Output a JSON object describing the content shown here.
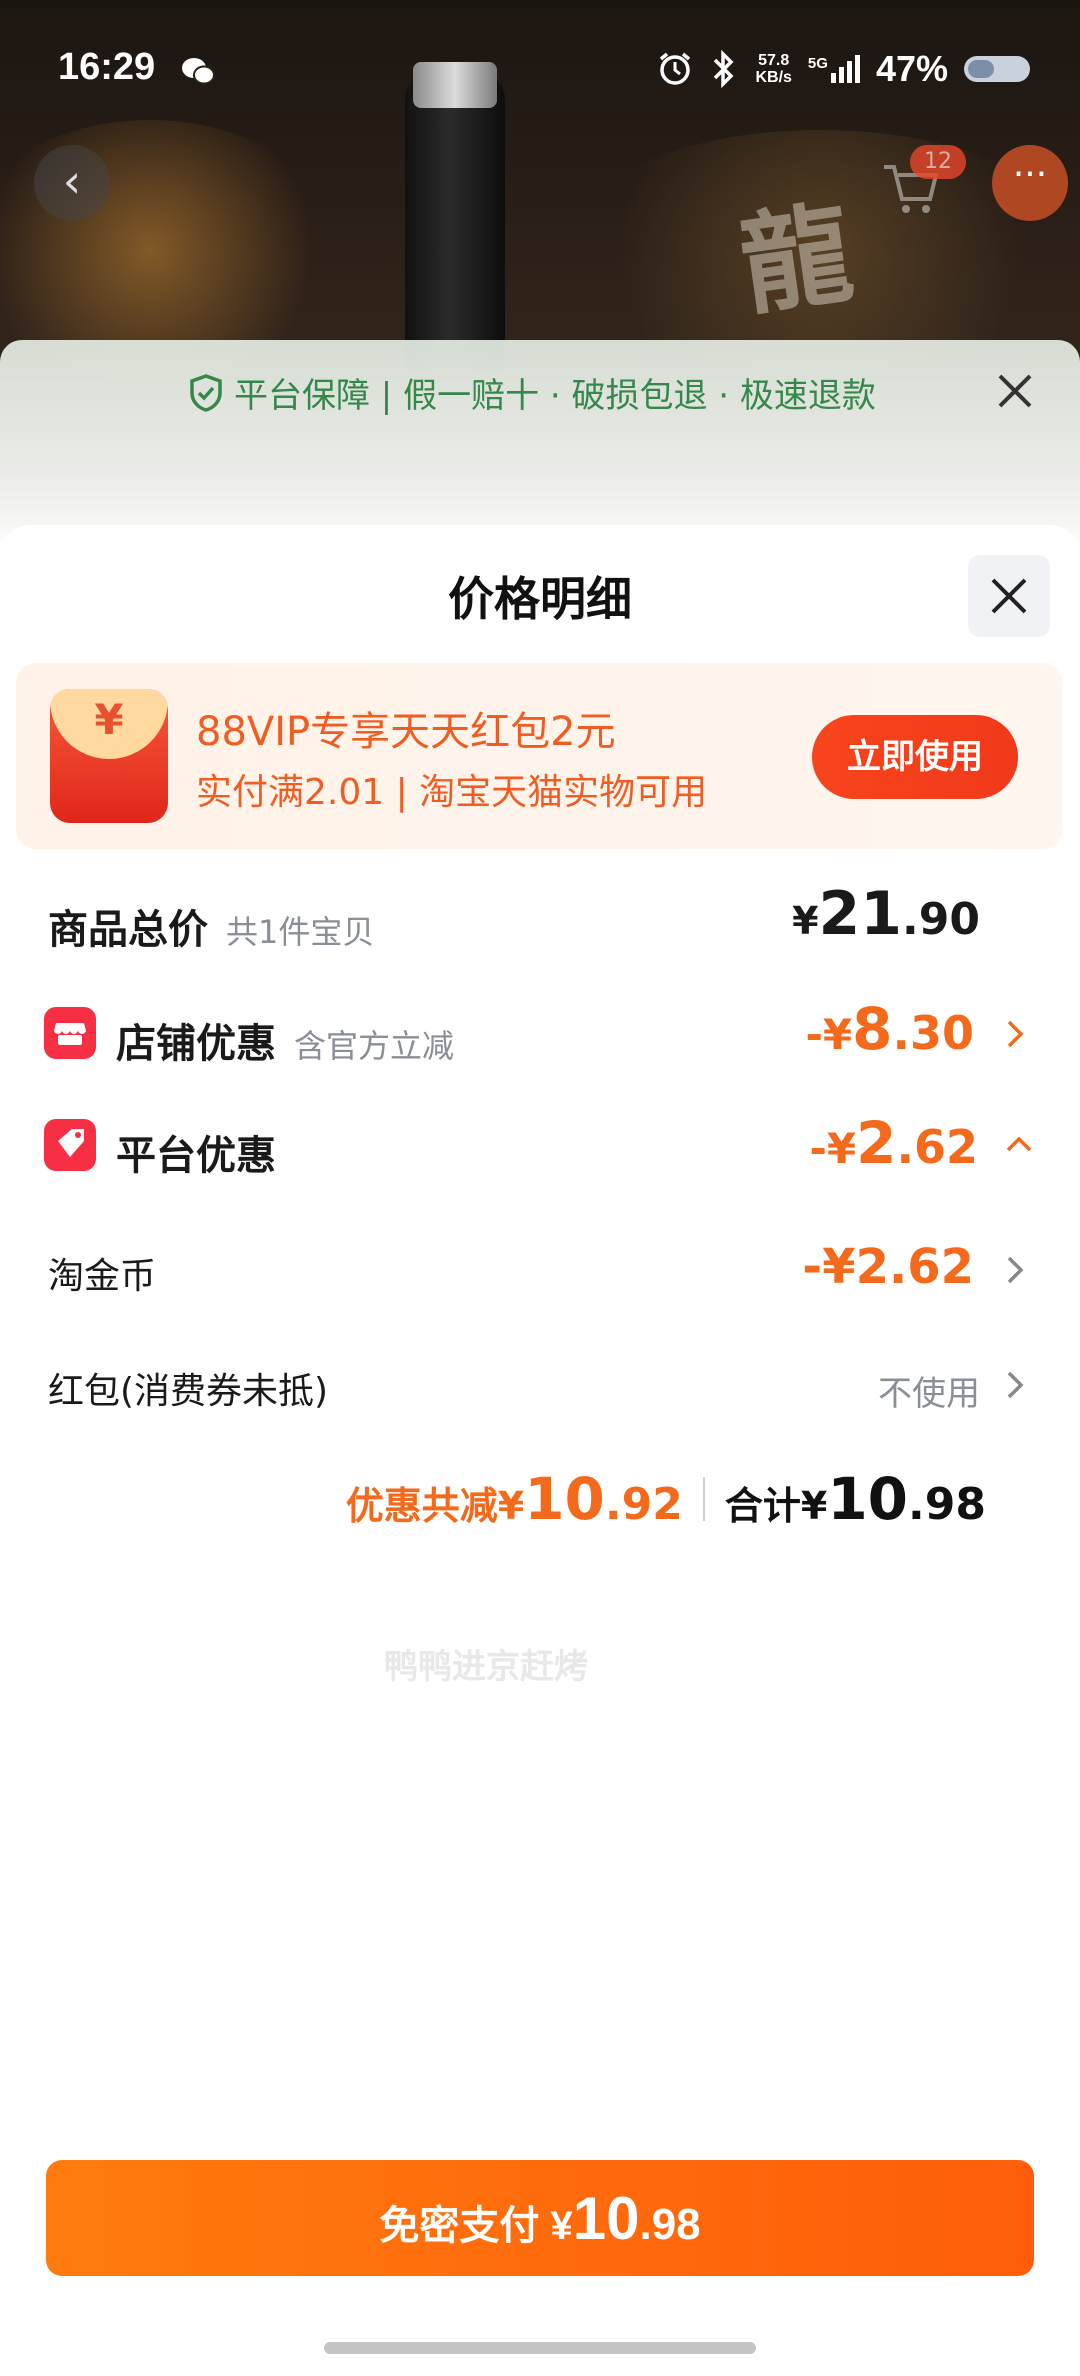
{
  "status_bar": {
    "time": "16:29",
    "net_speed_top": "57.8",
    "net_speed_bottom": "KB/s",
    "network": "5G",
    "battery": "47%"
  },
  "background": {
    "cart_count": "12",
    "dragon_char": "龍"
  },
  "guarantee": {
    "text": "平台保障 | 假一赔十 · 破损包退 · 极速退款"
  },
  "sheet": {
    "title": "价格明细"
  },
  "promo": {
    "line1": "88VIP专享天天红包2元",
    "line2": "实付满2.01 | 淘宝天猫实物可用",
    "button": "立即使用",
    "yen_symbol": "¥"
  },
  "rows": {
    "goods_total": {
      "label": "商品总价",
      "sub": "共1件宝贝",
      "currency": "¥",
      "int": "21",
      "dec": ".90"
    },
    "store_discount": {
      "label": "店铺优惠",
      "sub": "含官方立减",
      "prefix": "-¥",
      "int": "8",
      "dec": ".30"
    },
    "platform_discount": {
      "label": "平台优惠",
      "prefix": "-¥",
      "int": "2",
      "dec": ".62"
    },
    "tao_coin": {
      "label": "淘金币",
      "value": "-¥2.62"
    },
    "red_packet": {
      "label": "红包(消费券未抵)",
      "value": "不使用"
    }
  },
  "watermark": "鸭鸭进京赶烤",
  "summary": {
    "save_label": "优惠共减¥",
    "save_int": "10",
    "save_dec": ".92",
    "total_label": "合计¥",
    "total_int": "10",
    "total_dec": ".98"
  },
  "pay_button": {
    "label": "免密支付 ¥",
    "int": "10",
    "dec": ".98"
  },
  "colors": {
    "accent_orange": "#f36a1c",
    "pay_button": "#ff6a0d",
    "promo_red": "#f0391a",
    "guarantee_green": "#36884a"
  }
}
